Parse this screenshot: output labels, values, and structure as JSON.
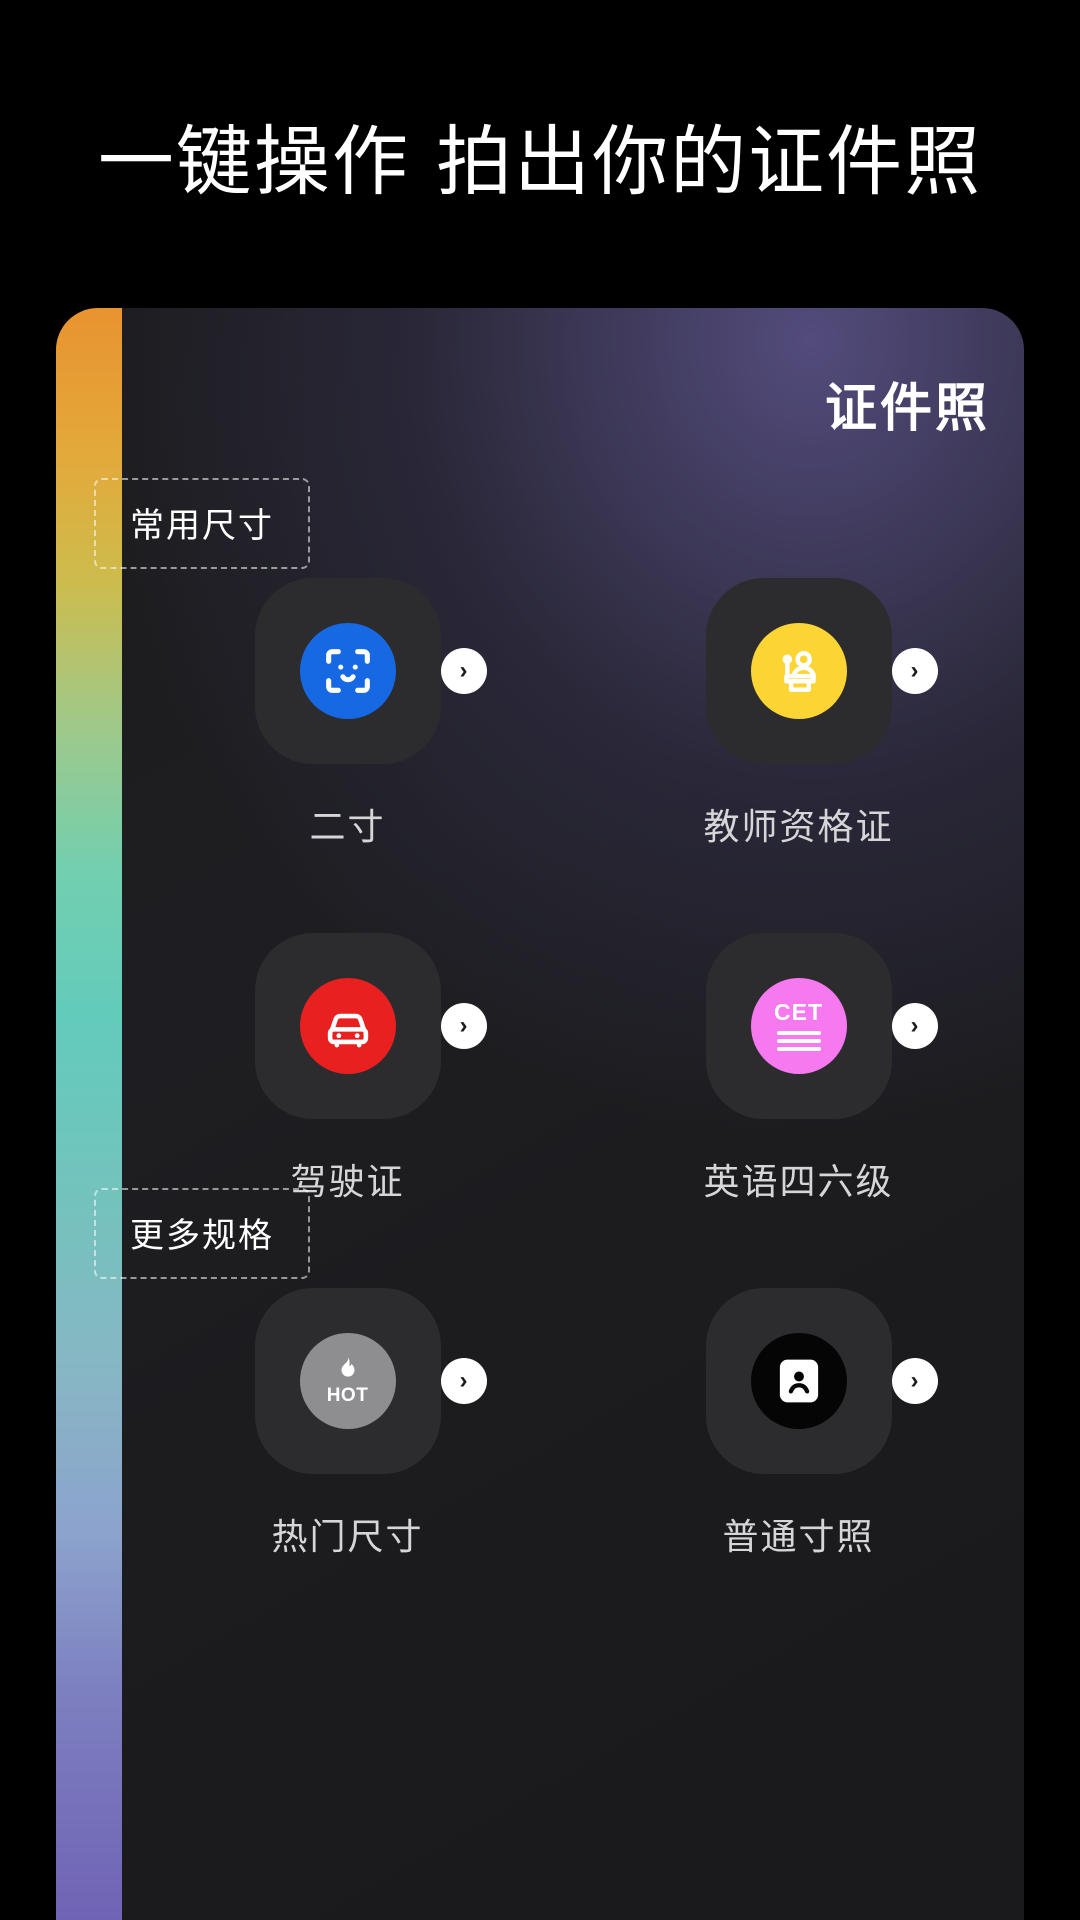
{
  "hero": {
    "title": "一键操作 拍出你的证件照",
    "sparkle_icon": "sparkle-icon"
  },
  "card": {
    "title": "证件照",
    "sparkle_icon": "sparkle-icon",
    "accent_strip_colors": [
      "#e8932f",
      "#cdbc4d",
      "#72cfb0",
      "#63cbbb",
      "#8ca3cd",
      "#6f63b5"
    ],
    "background_color": "#1c1c1e",
    "tile_background": "#2c2c2e",
    "chevron_glyph": "›",
    "sections": [
      {
        "label": "常用尺寸",
        "items": [
          {
            "label": "二寸",
            "icon": "face-id-icon",
            "color": "#1668e3"
          },
          {
            "label": "教师资格证",
            "icon": "teacher-podium-icon",
            "color": "#fcd535"
          },
          {
            "label": "驾驶证",
            "icon": "car-icon",
            "color": "#e8201f"
          },
          {
            "label": "英语四六级",
            "icon": "cet-icon",
            "color": "#f779ef",
            "badge_text": "CET"
          }
        ]
      },
      {
        "label": "更多规格",
        "items": [
          {
            "label": "热门尺寸",
            "icon": "hot-flame-icon",
            "color": "#8e8e90",
            "badge_text": "HOT"
          },
          {
            "label": "普通寸照",
            "icon": "id-portrait-icon",
            "color": "#050505"
          }
        ]
      }
    ]
  }
}
